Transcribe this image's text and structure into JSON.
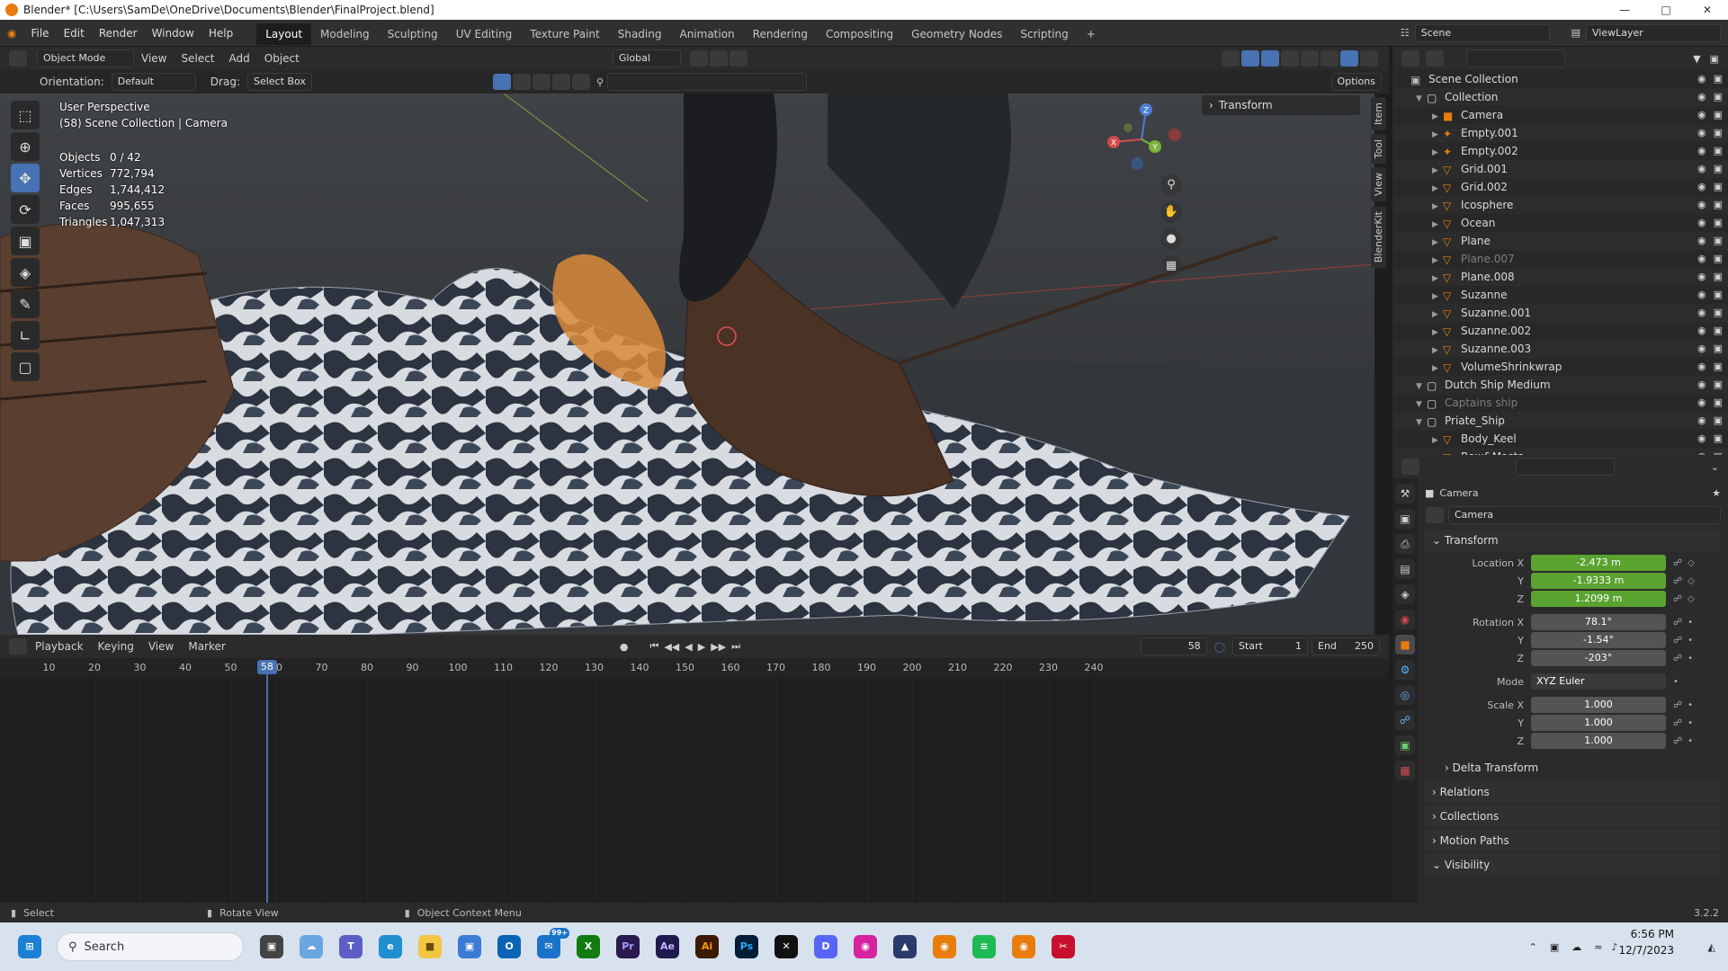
{
  "window": {
    "title": "Blender* [C:\\Users\\SamDe\\OneDrive\\Documents\\Blender\\FinalProject.blend]"
  },
  "menu": [
    "File",
    "Edit",
    "Render",
    "Window",
    "Help"
  ],
  "workspaces": [
    "Layout",
    "Modeling",
    "Sculpting",
    "UV Editing",
    "Texture Paint",
    "Shading",
    "Animation",
    "Rendering",
    "Compositing",
    "Geometry Nodes",
    "Scripting"
  ],
  "topright": {
    "scene": "Scene",
    "viewlayer": "ViewLayer"
  },
  "viewport_header": {
    "mode": "Object Mode",
    "view": "View",
    "select": "Select",
    "add": "Add",
    "object": "Object",
    "transform_space": "Global",
    "options": "Options",
    "orientation_label": "Orientation:",
    "orientation_value": "Default",
    "drag_label": "Drag:",
    "drag_value": "Select Box"
  },
  "overlay": {
    "view_name": "User Perspective",
    "context": "(58) Scene Collection | Camera",
    "stats": [
      {
        "label": "Objects",
        "value": "0 / 42"
      },
      {
        "label": "Vertices",
        "value": "772,794"
      },
      {
        "label": "Edges",
        "value": "1,744,412"
      },
      {
        "label": "Faces",
        "value": "995,655"
      },
      {
        "label": "Triangles",
        "value": "1,047,313"
      }
    ],
    "transform_panel": "Transform",
    "npanel_tabs": [
      "Item",
      "Tool",
      "View",
      "BlenderKit"
    ]
  },
  "gizmo": {
    "x": "X",
    "y": "Y",
    "z": "Z"
  },
  "timeline": {
    "menus": [
      "Playback",
      "Keying",
      "View",
      "Marker"
    ],
    "current_frame": "58",
    "start_label": "Start",
    "start": "1",
    "end_label": "End",
    "end": "250",
    "ticks": [
      "10",
      "20",
      "30",
      "40",
      "50",
      "60",
      "70",
      "80",
      "90",
      "100",
      "110",
      "120",
      "130",
      "140",
      "150",
      "160",
      "170",
      "180",
      "190",
      "200",
      "210",
      "220",
      "230",
      "240"
    ]
  },
  "statusbar": {
    "select": "Select",
    "rotate": "Rotate View",
    "context": "Object Context Menu",
    "version": "3.2.2"
  },
  "outliner": {
    "items": [
      {
        "name": "Scene Collection",
        "type": "scene",
        "indent": 0
      },
      {
        "name": "Collection",
        "type": "collection",
        "indent": 1
      },
      {
        "name": "Camera",
        "type": "camera",
        "indent": 2
      },
      {
        "name": "Empty.001",
        "type": "empty",
        "indent": 2
      },
      {
        "name": "Empty.002",
        "type": "empty",
        "indent": 2
      },
      {
        "name": "Grid.001",
        "type": "mesh",
        "indent": 2
      },
      {
        "name": "Grid.002",
        "type": "mesh",
        "indent": 2
      },
      {
        "name": "Icosphere",
        "type": "mesh",
        "indent": 2
      },
      {
        "name": "Ocean",
        "type": "mesh",
        "indent": 2
      },
      {
        "name": "Plane",
        "type": "mesh",
        "indent": 2
      },
      {
        "name": "Plane.007",
        "type": "mesh",
        "indent": 2,
        "dim": true
      },
      {
        "name": "Plane.008",
        "type": "mesh",
        "indent": 2
      },
      {
        "name": "Suzanne",
        "type": "mesh",
        "indent": 2
      },
      {
        "name": "Suzanne.001",
        "type": "mesh",
        "indent": 2
      },
      {
        "name": "Suzanne.002",
        "type": "mesh",
        "indent": 2
      },
      {
        "name": "Suzanne.003",
        "type": "mesh",
        "indent": 2
      },
      {
        "name": "VolumeShrinkwrap",
        "type": "mesh",
        "indent": 2
      },
      {
        "name": "Dutch Ship Medium",
        "type": "collection",
        "indent": 1
      },
      {
        "name": "Captains ship",
        "type": "collection",
        "indent": 1,
        "dim": true
      },
      {
        "name": "Priate_Ship",
        "type": "collection",
        "indent": 1
      },
      {
        "name": "Body_Keel",
        "type": "mesh",
        "indent": 2
      },
      {
        "name": "Bow&Masts",
        "type": "mesh",
        "indent": 2
      }
    ]
  },
  "properties": {
    "object_name": "Camera",
    "data_name": "Camera",
    "transform_label": "Transform",
    "location": {
      "label_x": "Location X",
      "label_y": "Y",
      "label_z": "Z",
      "x": "-2.473 m",
      "y": "-1.9333 m",
      "z": "1.2099 m"
    },
    "rotation": {
      "label_x": "Rotation X",
      "label_y": "Y",
      "label_z": "Z",
      "x": "78.1°",
      "y": "-1.54°",
      "z": "-203°"
    },
    "mode_label": "Mode",
    "mode": "XYZ Euler",
    "scale": {
      "label_x": "Scale X",
      "label_y": "Y",
      "label_z": "Z",
      "x": "1.000",
      "y": "1.000",
      "z": "1.000"
    },
    "sections": [
      "Delta Transform",
      "Relations",
      "Collections",
      "Motion Paths",
      "Visibility"
    ]
  },
  "taskbar": {
    "search": "Search",
    "time": "6:56 PM",
    "date": "12/7/2023",
    "badge_count": "99+"
  },
  "colors": {
    "accent": "#4772b3",
    "animated": "#5aa331",
    "orange": "#e87d0d"
  }
}
